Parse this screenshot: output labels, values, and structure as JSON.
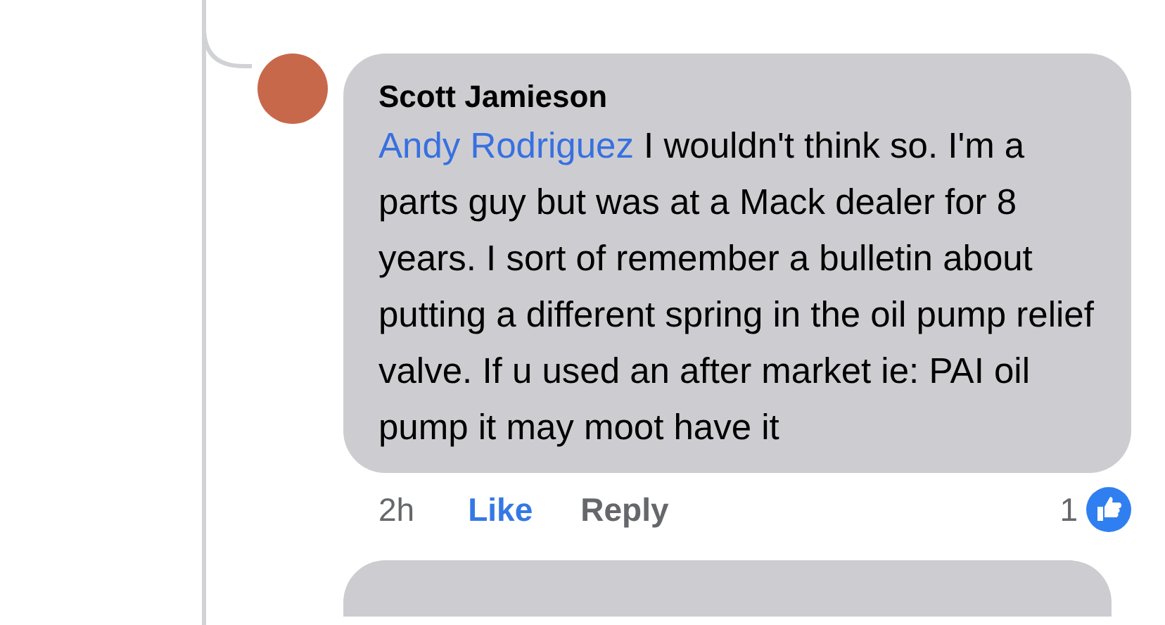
{
  "comment": {
    "author": "Scott Jamieson",
    "mention": "Andy Rodriguez",
    "text": "I wouldn't think so. I'm a parts guy but was at a Mack dealer for 8 years. I sort of remember a bulletin about putting a different spring in the oil pump relief valve. If u used an after market ie: PAI oil pump it may moot have it",
    "time": "2h",
    "like_label": "Like",
    "liked": true,
    "reply_label": "Reply",
    "reaction_count": "1"
  }
}
